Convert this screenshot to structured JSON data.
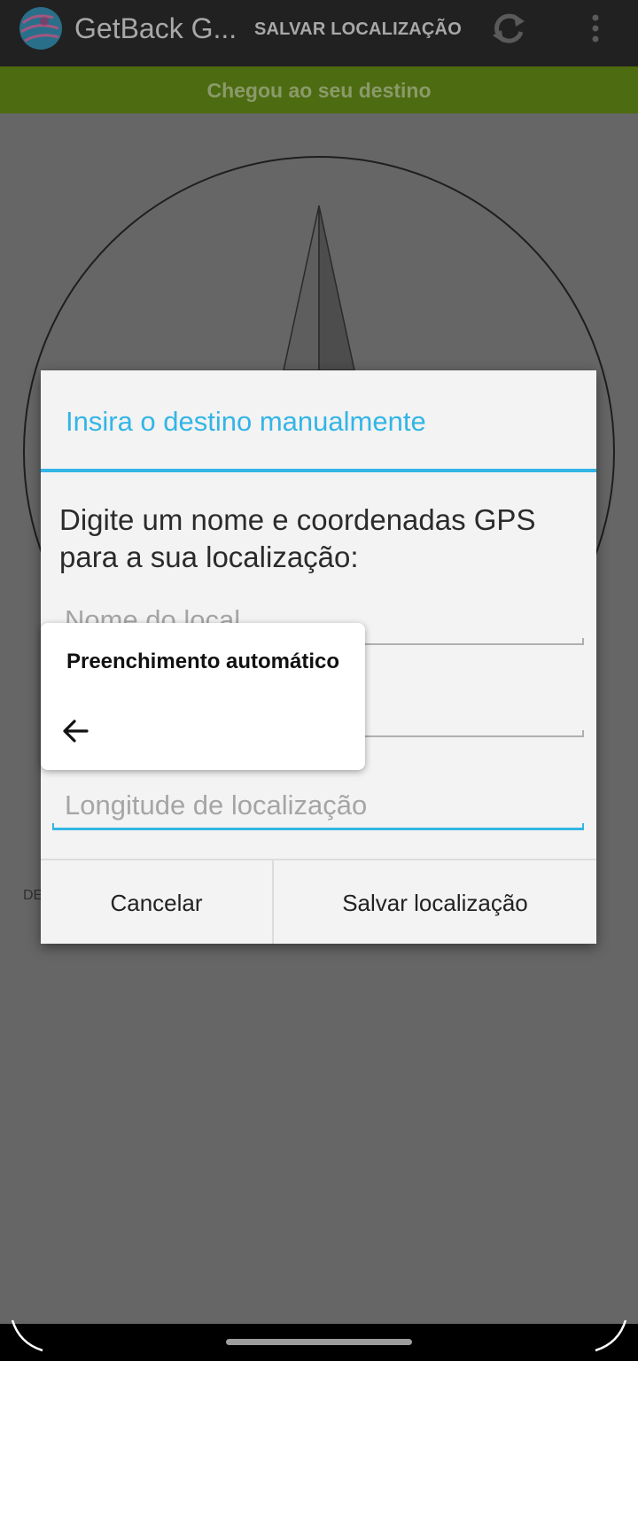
{
  "app_bar": {
    "title": "GetBack G...",
    "save_action": "SALVAR LOCALIZAÇÃO",
    "refresh_icon": "refresh-icon",
    "overflow_icon": "more-vert-icon"
  },
  "status": {
    "text": "Chegou ao seu destino",
    "color": "#4d6b10"
  },
  "background": {
    "partial_label": "DE"
  },
  "dialog": {
    "title": "Insira o destino manualmente",
    "message": "Digite um nome e coordenadas GPS para a sua localização:",
    "fields": {
      "name_placeholder": "Nome do local",
      "latitude_placeholder": "",
      "longitude_placeholder": "Longitude de localização"
    },
    "cancel_label": "Cancelar",
    "save_label": "Salvar localização",
    "accent_color": "#33b5e5"
  },
  "autofill": {
    "title": "Preenchimento automático",
    "back_icon": "arrow-back-icon"
  }
}
